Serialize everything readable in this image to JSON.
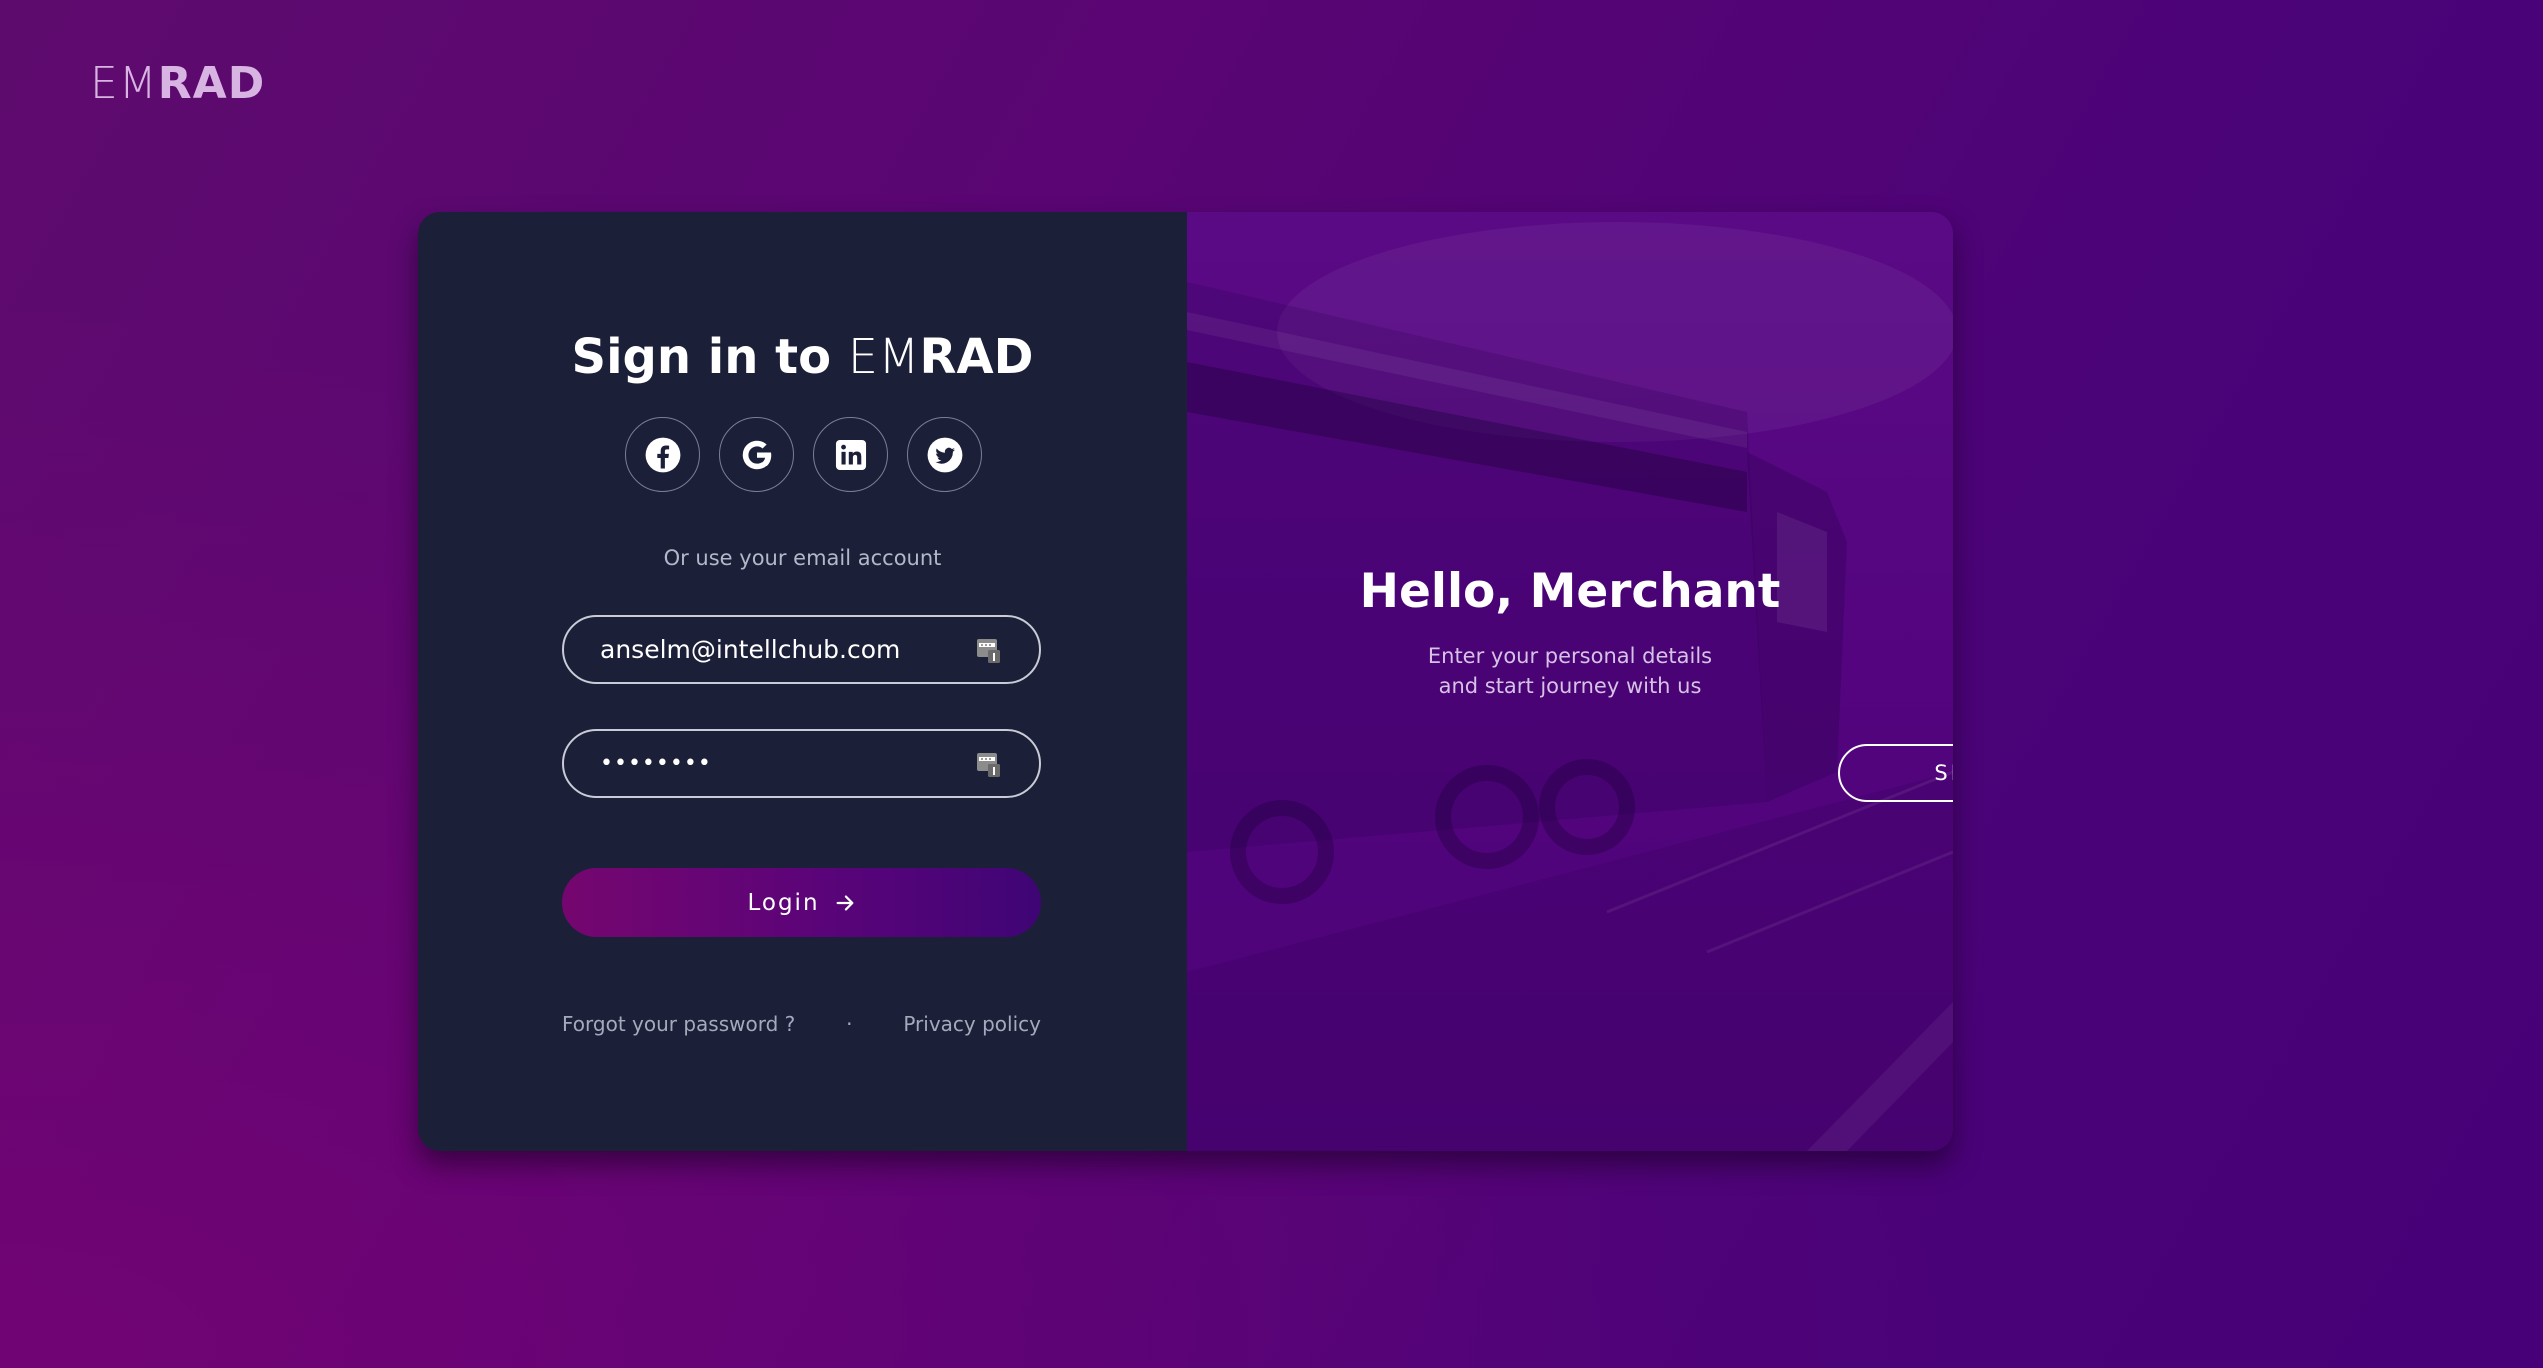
{
  "brand": {
    "em": "EM",
    "rad": "RAD"
  },
  "signin": {
    "title_prefix": "Sign in to ",
    "title_em": "EM",
    "title_rad": "RAD",
    "socials": [
      "facebook-icon",
      "google-icon",
      "linkedin-icon",
      "twitter-icon"
    ],
    "or_text": "Or use your email account",
    "email_value": "anselm@intellchub.com",
    "password_value": "abcdefgh",
    "login_label": "Login",
    "forgot_label": "Forgot your password ?",
    "separator": "·",
    "privacy_label": "Privacy policy"
  },
  "promo": {
    "title": "Hello, Merchant",
    "subtitle_line1": "Enter your personal details",
    "subtitle_line2": "and start journey with us",
    "signup_label": "SIGN UP"
  },
  "colors": {
    "card_left": "#1b1f38",
    "accent_start": "#76066f",
    "accent_end": "#3f0575",
    "background": "#53047a"
  }
}
